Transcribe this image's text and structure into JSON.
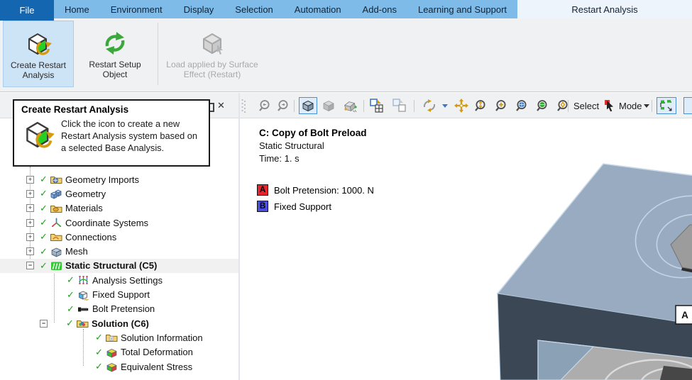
{
  "tabbar": {
    "file_label": "File",
    "tabs": [
      "Home",
      "Environment",
      "Display",
      "Selection",
      "Automation",
      "Add-ons",
      "Learning and Support",
      "Restart Analysis"
    ],
    "active_tab": "Restart Analysis",
    "colors": {
      "bar": "#7FBBE8",
      "file_bg": "#1566B0",
      "active_bg": "#EDF4FB"
    }
  },
  "ribbon": {
    "buttons": [
      {
        "label": "Create Restart Analysis",
        "icon": "restart-cube-icon",
        "state": "highlighted"
      },
      {
        "label": "Restart Setup Object",
        "icon": "green-recycle-icon",
        "state": "normal"
      },
      {
        "label": "Load applied by Surface Effect (Restart)",
        "icon": "gray-cube-cursor-icon",
        "state": "disabled"
      }
    ]
  },
  "tooltip": {
    "title": "Create Restart Analysis",
    "body": "Click the icon to create a new Restart Analysis system based on a selected Base Analysis.",
    "icon": "restart-cube-icon"
  },
  "outline_panel": {
    "window_buttons": [
      "maximize",
      "close"
    ],
    "items": [
      {
        "label": "Geometry Imports",
        "level": 0,
        "expander": "+",
        "icon": "folder-globe",
        "checked": true
      },
      {
        "label": "Geometry",
        "level": 0,
        "expander": "+",
        "icon": "geometry-cubes",
        "checked": true
      },
      {
        "label": "Materials",
        "level": 0,
        "expander": "+",
        "icon": "folder-material",
        "checked": true
      },
      {
        "label": "Coordinate Systems",
        "level": 0,
        "expander": "+",
        "icon": "coordinate-axes",
        "checked": true
      },
      {
        "label": "Connections",
        "level": 0,
        "expander": "+",
        "icon": "folder-connections",
        "checked": true
      },
      {
        "label": "Mesh",
        "level": 0,
        "expander": "+",
        "icon": "mesh-cube",
        "checked": true
      },
      {
        "label": "Static Structural (C5)",
        "level": 0,
        "expander": "-",
        "icon": "static-structural",
        "checked": true,
        "bold": true,
        "selected": true
      },
      {
        "label": "Analysis Settings",
        "level": 1,
        "expander": "",
        "icon": "analysis-settings",
        "checked": true
      },
      {
        "label": "Fixed Support",
        "level": 1,
        "expander": "",
        "icon": "fixed-support",
        "checked": true
      },
      {
        "label": "Bolt Pretension",
        "level": 1,
        "expander": "",
        "icon": "bolt-pretension",
        "checked": true
      },
      {
        "label": "Solution (C6)",
        "level": 1,
        "expander": "-",
        "icon": "solution-folder",
        "checked": true,
        "bold": true
      },
      {
        "label": "Solution Information",
        "level": 2,
        "expander": "",
        "icon": "solution-info",
        "checked": true
      },
      {
        "label": "Total Deformation",
        "level": 2,
        "expander": "",
        "icon": "result-cube",
        "checked": true
      },
      {
        "label": "Equivalent Stress",
        "level": 2,
        "expander": "",
        "icon": "result-cube",
        "checked": true
      }
    ]
  },
  "viewport": {
    "toolbar": {
      "select_label": "Select",
      "mode_label": "Mode",
      "icons": [
        "grip",
        "zoom-prev-icon",
        "zoom-next-icon",
        "view-cube-icon",
        "shaded-cube-icon",
        "edge-color-cube-icon",
        "split-window-icon",
        "split-window-alt-icon",
        "rotate-icon",
        "dropdown-caret",
        "pan-icon",
        "zoom-icon",
        "zoom-box-icon",
        "zoom-fit-icon",
        "zoom-fit-green-icon",
        "zoom-extents-icon",
        "cursor-select-icon",
        "dropdown-caret",
        "wireframe-select-icon"
      ]
    },
    "annotation": {
      "title": "C: Copy of Bolt Preload",
      "subtitle": "Static Structural",
      "time": "Time: 1. s",
      "loads": [
        {
          "badge": "A",
          "badge_color": "#E8232B",
          "text": "Bolt Pretension: 1000. N"
        },
        {
          "badge": "B",
          "badge_color": "#4A4FE0",
          "text": "Fixed Support"
        }
      ]
    },
    "model": {
      "label": "A",
      "colors": {
        "top_face": "#98ABC0",
        "front_face": "#3B4754",
        "section_gray": "#ADADAD",
        "inner_blue": "#8BA1B6",
        "bolt_head": "#9C9C9C"
      }
    }
  }
}
